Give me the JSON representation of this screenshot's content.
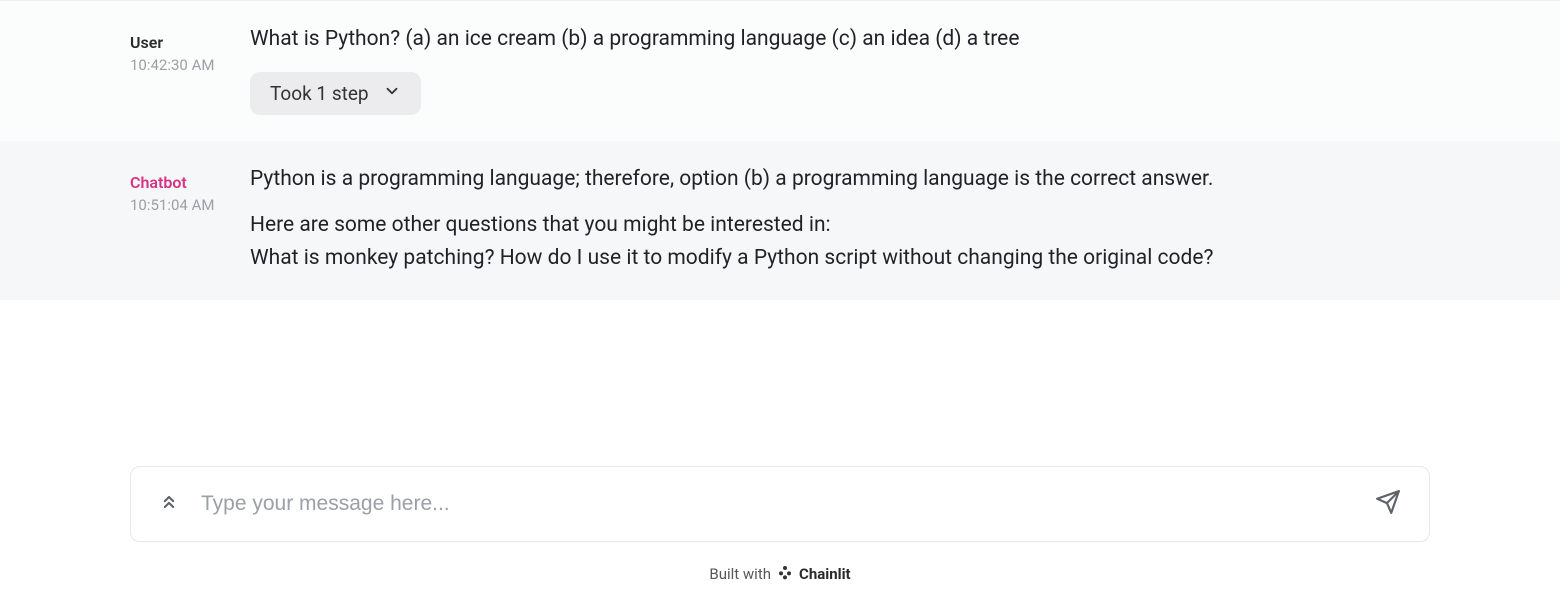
{
  "messages": [
    {
      "sender_label": "User",
      "sender_role": "user",
      "timestamp": "10:42:30 AM",
      "text": "What is Python? (a) an ice cream (b) a programming language (c) an idea (d) a tree",
      "steps_label": "Took 1 step"
    },
    {
      "sender_label": "Chatbot",
      "sender_role": "bot",
      "timestamp": "10:51:04 AM",
      "text_p1": "Python is a programming language; therefore, option (b) a programming language is the correct answer.",
      "text_p2_line1": "Here are some other questions that you might be interested in:",
      "text_p2_line2": "What is monkey patching? How do I use it to modify a Python script without changing the original code?"
    }
  ],
  "input": {
    "placeholder": "Type your message here..."
  },
  "footer": {
    "prefix": "Built with",
    "brand": "Chainlit"
  }
}
